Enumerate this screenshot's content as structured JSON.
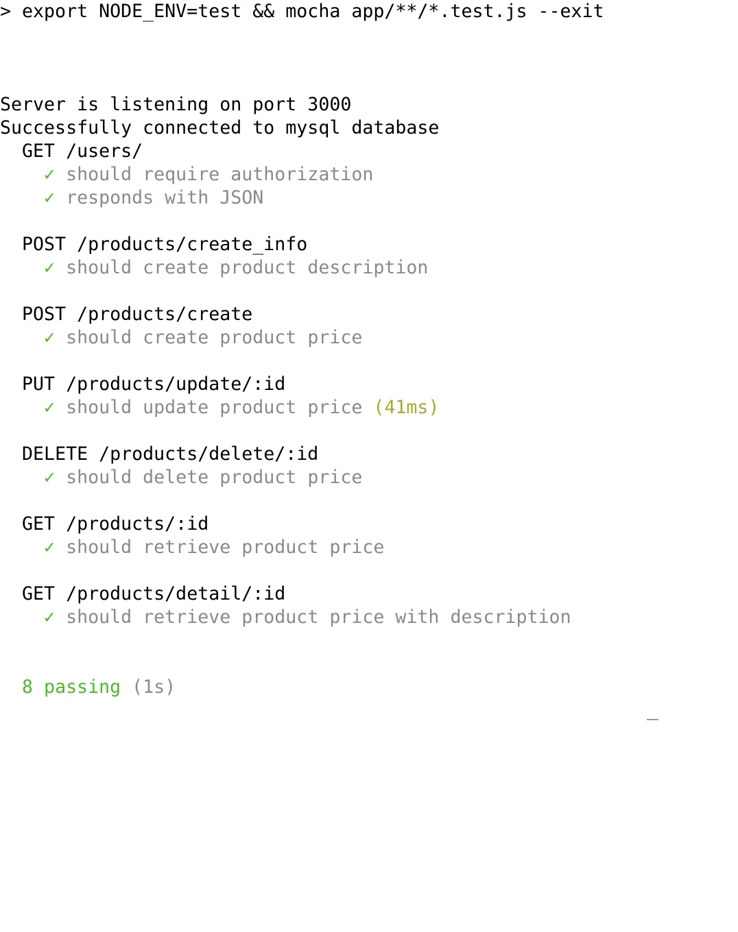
{
  "terminal": {
    "command": "> export NODE_ENV=test && mocha app/**/*.test.js --exit",
    "server_message": "Server is listening on port 3000",
    "db_message": "Successfully connected to mysql database",
    "check_mark": "✓",
    "suites": [
      {
        "title": "GET /users/",
        "tests": [
          {
            "name": "should require authorization"
          },
          {
            "name": "responds with JSON"
          }
        ]
      },
      {
        "title": "POST /products/create_info",
        "tests": [
          {
            "name": "should create product description"
          }
        ]
      },
      {
        "title": "POST /products/create",
        "tests": [
          {
            "name": "should create product price"
          }
        ]
      },
      {
        "title": "PUT /products/update/:id",
        "tests": [
          {
            "name": "should update product price",
            "duration": "(41ms)"
          }
        ]
      },
      {
        "title": "DELETE /products/delete/:id",
        "tests": [
          {
            "name": "should delete product price"
          }
        ]
      },
      {
        "title": "GET /products/:id",
        "tests": [
          {
            "name": "should retrieve product price"
          }
        ]
      },
      {
        "title": "GET /products/detail/:id",
        "tests": [
          {
            "name": "should retrieve product price with description"
          }
        ]
      }
    ],
    "summary": {
      "passing": "8 passing",
      "duration": "(1s)"
    },
    "colors": {
      "pass": "#4eb82a",
      "muted": "#8a8a8a",
      "slow": "#a8a832"
    }
  }
}
